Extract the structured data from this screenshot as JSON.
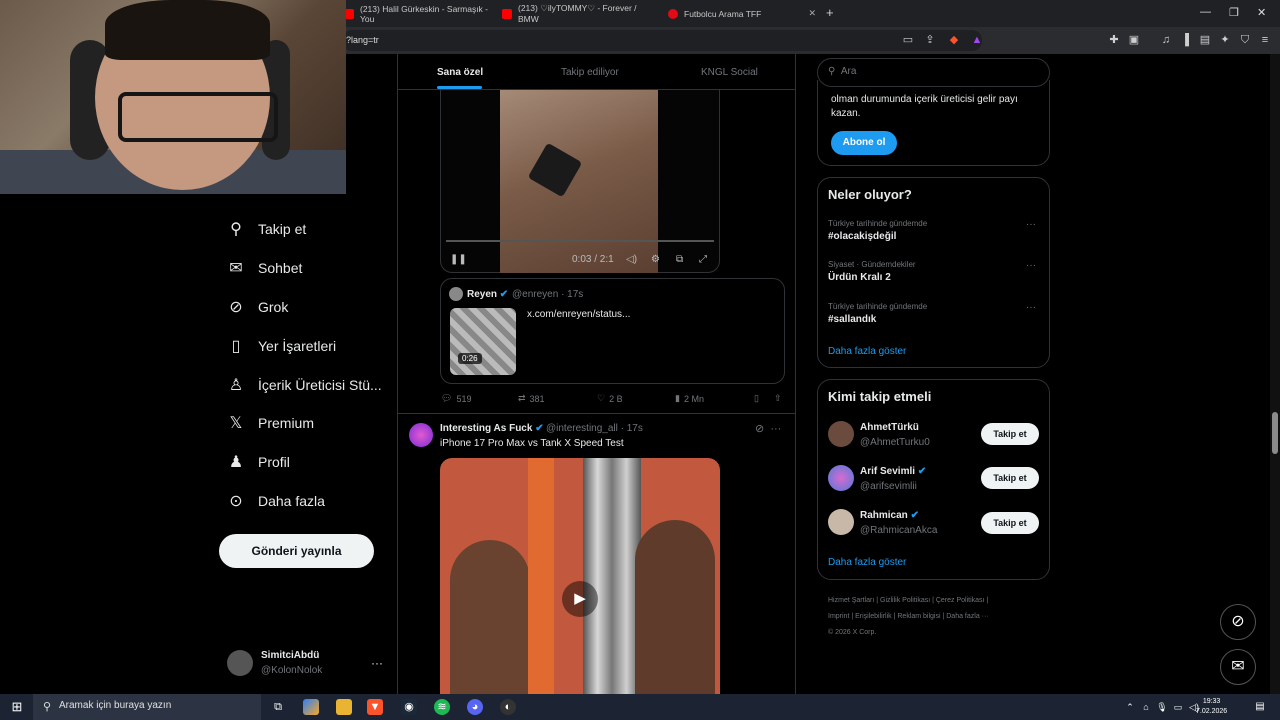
{
  "browser": {
    "tabs": [
      {
        "label": "(213) Halil Gürkeskin - Sarmaşık - You",
        "icon": "youtube-icon",
        "color": "#ff0000"
      },
      {
        "label": "(213) ♡ilyTOMMY♡ - Forever / BMW",
        "icon": "youtube-icon",
        "color": "#ff0000"
      },
      {
        "label": "Futbolcu Arama TFF",
        "icon": "tff-icon",
        "color": "#e30a17"
      }
    ],
    "url": "?lang=tr"
  },
  "nav": {
    "items": [
      {
        "label": "Takip et",
        "icon": "add-user-icon"
      },
      {
        "label": "Sohbet",
        "icon": "mail-icon"
      },
      {
        "label": "Grok",
        "icon": "grok-icon"
      },
      {
        "label": "Yer İşaretleri",
        "icon": "bookmark-icon"
      },
      {
        "label": "İçerik Üreticisi Stü...",
        "icon": "creator-icon"
      },
      {
        "label": "Premium",
        "icon": "x-logo-icon"
      },
      {
        "label": "Profil",
        "icon": "profile-icon"
      },
      {
        "label": "Daha fazla",
        "icon": "more-circle-icon"
      }
    ],
    "post_button": "Gönderi yayınla",
    "account": {
      "name": "SimitciAbdü",
      "handle": "@KolonNolok"
    }
  },
  "feed": {
    "tabs": [
      "Sana özel",
      "Takip ediliyor",
      "KNGL Social"
    ],
    "video1": {
      "time": "0:03 / 2:1"
    },
    "quote": {
      "name": "Reyen",
      "handle": "@enreyen · 17s",
      "duration": "0:26",
      "link": "x.com/enreyen/status..."
    },
    "actions": {
      "replies": "519",
      "reposts": "381",
      "likes": "2 B",
      "views": "2 Mn"
    },
    "post2": {
      "name": "Interesting As Fuck",
      "handle": "@interesting_all · 17s",
      "text": "iPhone 17 Pro Max vs Tank X Speed Test"
    }
  },
  "sidebar_right": {
    "search_placeholder": "Ara",
    "subscribe": {
      "text": "olman durumunda içerik üreticisi gelir payı kazan.",
      "button": "Abone ol"
    },
    "trends": {
      "title": "Neler oluyor?",
      "items": [
        {
          "meta": "Türkiye tarihinde gündemde",
          "title": "#olacakişdeğil"
        },
        {
          "meta": "Siyaset · Gündemdekiler",
          "title": "Ürdün Kralı 2"
        },
        {
          "meta": "Türkiye tarihinde gündemde",
          "title": "#sallandık"
        }
      ],
      "more": "Daha fazla göster"
    },
    "who_to_follow": {
      "title": "Kimi takip etmeli",
      "items": [
        {
          "name": "AhmetTürkü",
          "handle": "@AhmetTurku0",
          "verified": false
        },
        {
          "name": "Arif Sevimli",
          "handle": "@arifsevimlii",
          "verified": true
        },
        {
          "name": "Rahmican",
          "handle": "@RahmicanAkca",
          "verified": true
        }
      ],
      "button": "Takip et",
      "more": "Daha fazla göster"
    },
    "footer": {
      "line1": "Hizmet Şartları  |  Gizlilik Politikası  |  Çerez Politikası  |",
      "line2": "Imprint  |  Erişilebilirlik  |  Reklam bilgisi  |  Daha fazla ···",
      "line3": "© 2026 X Corp."
    }
  },
  "taskbar": {
    "search_placeholder": "Aramak için buraya yazın",
    "time": "19:33",
    "date": "7.02.2026"
  }
}
